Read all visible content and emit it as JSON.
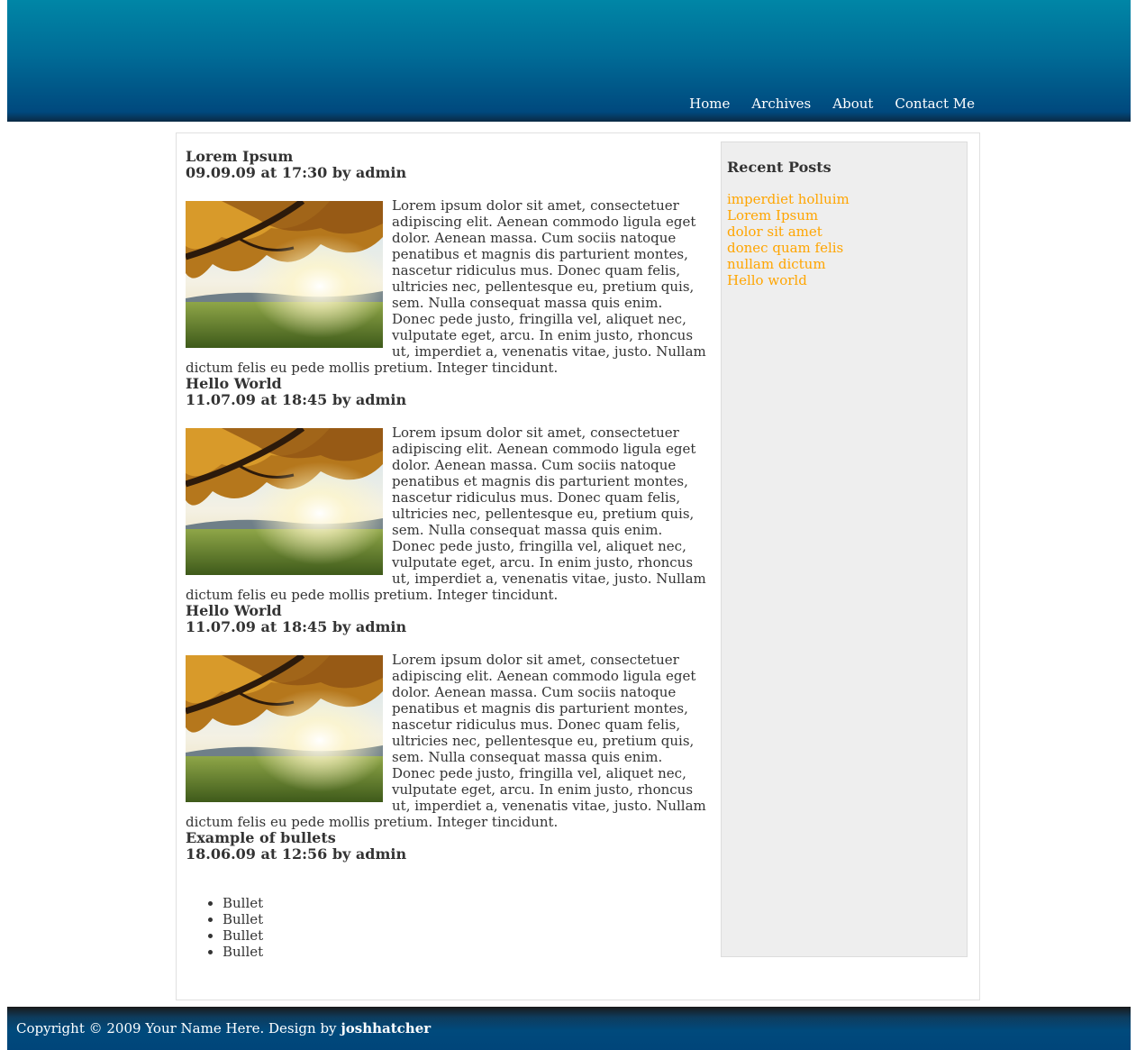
{
  "nav": {
    "items": [
      "Home",
      "Archives",
      "About",
      "Contact Me"
    ]
  },
  "posts": [
    {
      "title": "Lorem Ipsum",
      "meta": "09.09.09 at 17:30 by admin",
      "body": "Lorem ipsum dolor sit amet, consectetuer adipiscing elit. Aenean commodo ligula eget dolor. Aenean massa. Cum sociis natoque penatibus et magnis dis parturient montes, nascetur ridiculus mus. Donec quam felis, ultricies nec, pellentesque eu, pretium quis, sem. Nulla consequat massa quis enim. Donec pede justo, fringilla vel, aliquet nec, vulputate eget, arcu. In enim justo, rhoncus ut, imperdiet a, venenatis vitae, justo. Nullam dictum felis eu pede mollis pretium. Integer tincidunt."
    },
    {
      "title": "Hello World",
      "meta": "11.07.09 at 18:45 by admin",
      "body": "Lorem ipsum dolor sit amet, consectetuer adipiscing elit. Aenean commodo ligula eget dolor. Aenean massa. Cum sociis natoque penatibus et magnis dis parturient montes, nascetur ridiculus mus. Donec quam felis, ultricies nec, pellentesque eu, pretium quis, sem. Nulla consequat massa quis enim. Donec pede justo, fringilla vel, aliquet nec, vulputate eget, arcu. In enim justo, rhoncus ut, imperdiet a, venenatis vitae, justo. Nullam dictum felis eu pede mollis pretium. Integer tincidunt."
    },
    {
      "title": "Hello World",
      "meta": "11.07.09 at 18:45 by admin",
      "body": "Lorem ipsum dolor sit amet, consectetuer adipiscing elit. Aenean commodo ligula eget dolor. Aenean massa. Cum sociis natoque penatibus et magnis dis parturient montes, nascetur ridiculus mus. Donec quam felis, ultricies nec, pellentesque eu, pretium quis, sem. Nulla consequat massa quis enim. Donec pede justo, fringilla vel, aliquet nec, vulputate eget, arcu. In enim justo, rhoncus ut, imperdiet a, venenatis vitae, justo. Nullam dictum felis eu pede mollis pretium. Integer tincidunt."
    },
    {
      "title": "Example of bullets",
      "meta": "18.06.09 at 12:56 by admin",
      "bullets": [
        "Bullet",
        "Bullet",
        "Bullet",
        "Bullet"
      ]
    }
  ],
  "sidebar": {
    "heading": "Recent Posts",
    "links": [
      "imperdiet holluim",
      "Lorem Ipsum",
      "dolor sit amet",
      "donec quam felis",
      "nullam dictum",
      "Hello world"
    ]
  },
  "footer": {
    "text": "Copyright © 2009 Your Name Here. Design by ",
    "author": "joshhatcher"
  },
  "colors": {
    "header": "#006c97",
    "link": "#ffa500",
    "sidebar_bg": "#eeeeee",
    "text": "#333333"
  }
}
